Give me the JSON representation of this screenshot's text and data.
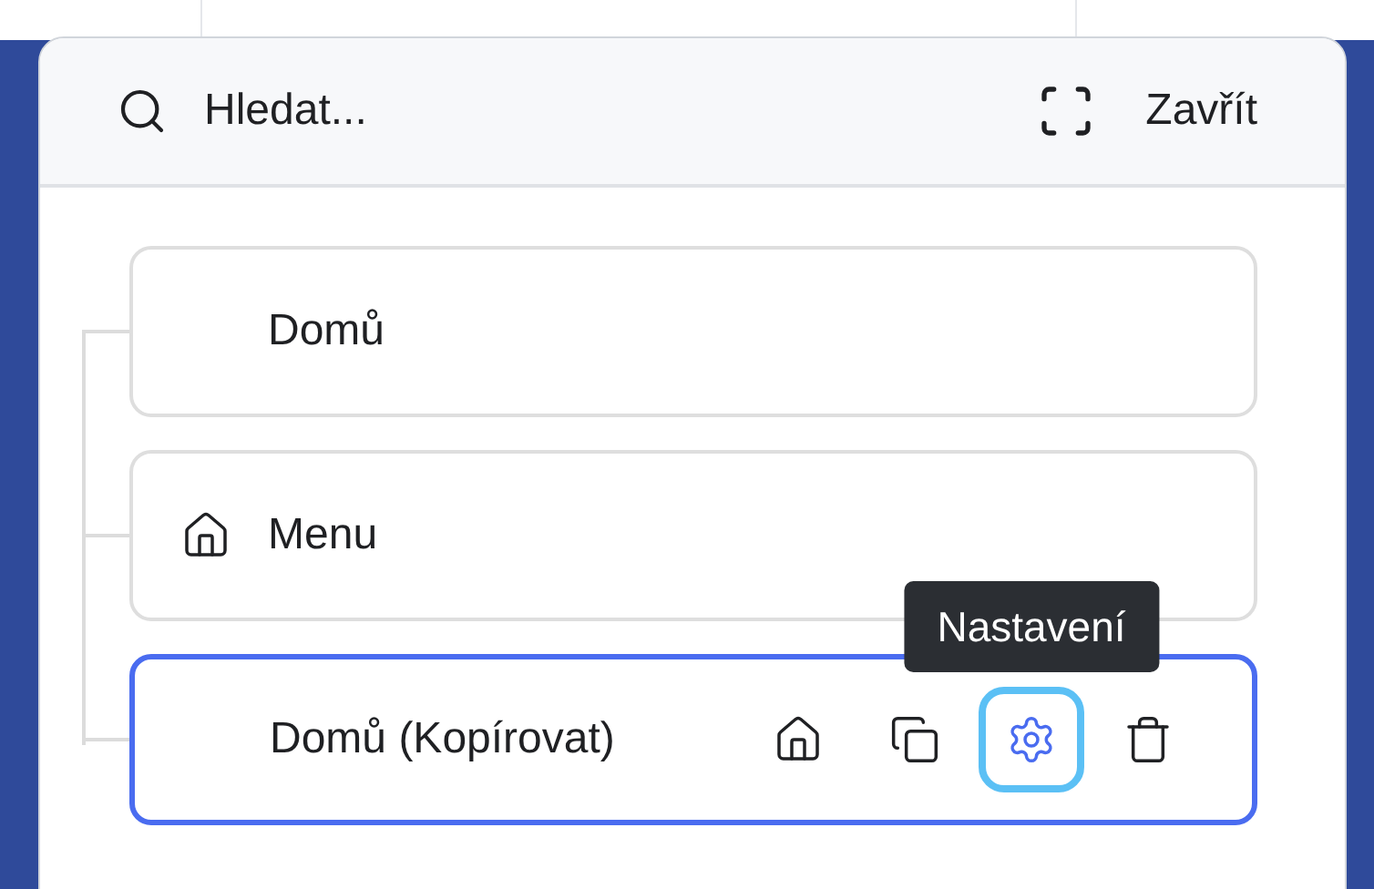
{
  "search": {
    "placeholder": "Hledat..."
  },
  "close_label": "Zavřít",
  "items": [
    {
      "label": "Domů",
      "show_icon": false,
      "selected": false
    },
    {
      "label": "Menu",
      "show_icon": true,
      "selected": false
    },
    {
      "label": "Domů (Kopírovat)",
      "show_icon": false,
      "selected": true,
      "actions": [
        {
          "kind": "home",
          "focused": false
        },
        {
          "kind": "copy",
          "focused": false
        },
        {
          "kind": "settings",
          "focused": true,
          "tooltip": "Nastavení"
        },
        {
          "kind": "delete",
          "focused": false
        }
      ]
    }
  ]
}
